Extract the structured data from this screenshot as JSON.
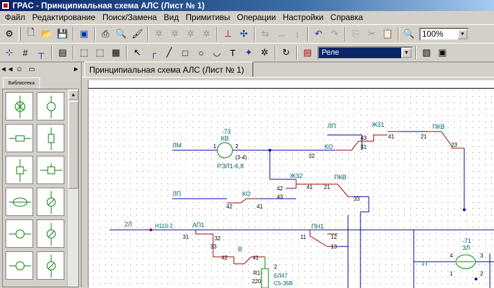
{
  "window": {
    "title": "ГРАС - Принципиальная схема АЛС (Лист № 1)"
  },
  "menu": {
    "items": [
      "Файл",
      "Редактирование",
      "Поиск/Замена",
      "Вид",
      "Примитивы",
      "Операции",
      "Настройки",
      "Справка"
    ]
  },
  "toolbar1": {
    "zoom": "100%"
  },
  "toolbar2": {
    "layer": "Реле"
  },
  "library": {
    "tab_label": "Библиотека"
  },
  "document": {
    "tab_label": "Принципиальная схема АЛС (Лист № 1)"
  },
  "schematic": {
    "labels": {
      "kv_num": "-73",
      "kv": "КВ",
      "lm": "ЛМ",
      "pin1": "1",
      "pin2": "2",
      "pin34": "(3-4)",
      "rel_type": "РЭЛ1-6,8",
      "lp1": "ЛП",
      "zh31": "Ж31",
      "pkv1": "ПКВ",
      "n43a": "43",
      "n41a": "41",
      "n21a": "21",
      "n23a": "23",
      "ko1": "КО",
      "n32a": "32",
      "n31a": "31",
      "zh32": "Ж32",
      "pkv2": "ПКВ",
      "n42a": "42",
      "n41b": "41",
      "n21b": "21",
      "n33a": "33",
      "lp2": "ЛП",
      "ko2": "КО",
      "n43b": "43",
      "n42b": "42",
      "n41c": "41",
      "l2": "2Л",
      "n110": "Н110-2",
      "ap1": "АП1",
      "n31b": "31",
      "n32b": "32",
      "n33b": "33",
      "n42c": "42",
      "v": "В",
      "n41d": "41",
      "pn1": "ПН1",
      "n11": "11",
      "n12": "12",
      "n13": "13",
      "r1": "R1-",
      "r220": "220",
      "n2": "2",
      "bl47": "БЛ47",
      "c5": "С5-35В",
      "zl_num": "-71",
      "zl": "ЗЛ",
      "n4": "4",
      "n3": "3",
      "n1": "1",
      "n2b": "2",
      "p": "-П"
    }
  }
}
